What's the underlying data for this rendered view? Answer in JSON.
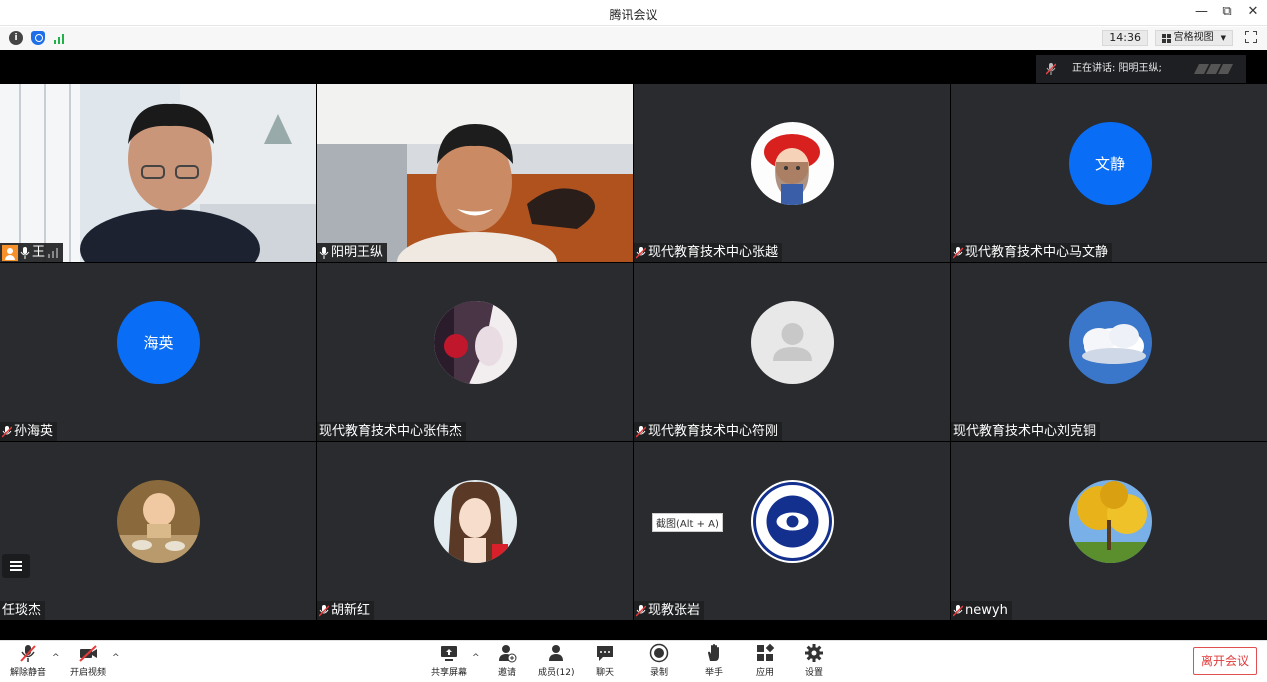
{
  "window": {
    "title": "腾讯会议",
    "minimize": "—",
    "restore": "⧉",
    "close": "✕"
  },
  "toolbar": {
    "time": "14:36",
    "view_label": "宫格视图"
  },
  "speaker": {
    "text": "正在讲话: 阳明王纵;"
  },
  "tiles": [
    {
      "name": "王",
      "type": "video"
    },
    {
      "name": "阳明王纵",
      "type": "video"
    },
    {
      "name": "现代教育技术中心张越",
      "type": "image"
    },
    {
      "name": "现代教育技术中心马文静",
      "type": "text",
      "avatar_text": "文静"
    },
    {
      "name": "孙海英",
      "type": "text",
      "avatar_text": "海英"
    },
    {
      "name": "现代教育技术中心张伟杰",
      "type": "image"
    },
    {
      "name": "现代教育技术中心符刚",
      "type": "placeholder"
    },
    {
      "name": "现代教育技术中心刘克铜",
      "type": "image"
    },
    {
      "name": "任琰杰",
      "type": "image"
    },
    {
      "name": "胡新红",
      "type": "image"
    },
    {
      "name": "现教张岩",
      "type": "image"
    },
    {
      "name": "newyh",
      "type": "image"
    }
  ],
  "tooltip": "截图(Alt + A)",
  "bottombar": {
    "unmute": "解除静音",
    "start_video": "开启视频",
    "share": "共享屏幕",
    "invite": "邀请",
    "members": "成员(12)",
    "chat": "聊天",
    "record": "录制",
    "raise_hand": "举手",
    "apps": "应用",
    "settings": "设置",
    "leave": "离开会议"
  },
  "colors": {
    "accent": "#0a6df5",
    "tile_bg": "#292b2e",
    "leave": "#e03a3a",
    "active_outline": "#3fbf5f"
  }
}
